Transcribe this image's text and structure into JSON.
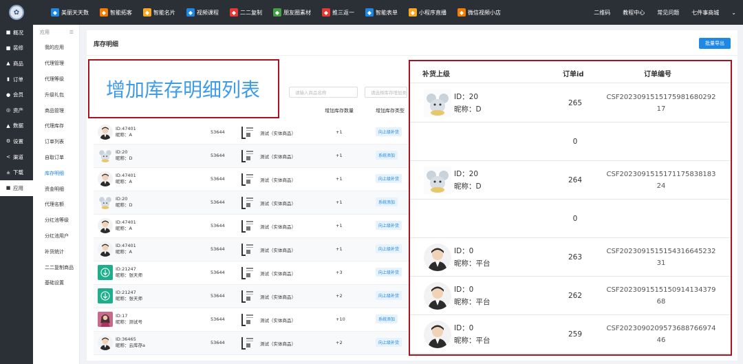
{
  "topnav": {
    "items": [
      {
        "label": "美丽天天数",
        "icon": "tag-icon",
        "color": "#1e88e5"
      },
      {
        "label": "智能拓客",
        "icon": "star-icon",
        "color": "#f57c00"
      },
      {
        "label": "智能名片",
        "icon": "card-icon",
        "color": "#f9a825"
      },
      {
        "label": "视频课程",
        "icon": "video-icon",
        "color": "#1e88e5"
      },
      {
        "label": "二二复制",
        "icon": "copy-icon",
        "color": "#e53935"
      },
      {
        "label": "朋友圈素材",
        "icon": "moments-icon",
        "color": "#43a047"
      },
      {
        "label": "推三返一",
        "icon": "gift-icon",
        "color": "#e53935"
      },
      {
        "label": "智能表单",
        "icon": "form-icon",
        "color": "#1e88e5"
      },
      {
        "label": "小程序直播",
        "icon": "live-icon",
        "color": "#f9a825"
      },
      {
        "label": "微信视频小店",
        "icon": "shop-icon",
        "color": "#f57c00"
      }
    ],
    "right": [
      "二维码",
      "教程中心",
      "常见问题",
      "七件事商城"
    ]
  },
  "sidebar": {
    "items": [
      {
        "label": "概况",
        "icon": "■"
      },
      {
        "label": "装修",
        "icon": "■"
      },
      {
        "label": "商品",
        "icon": "▲"
      },
      {
        "label": "订单",
        "icon": "▮"
      },
      {
        "label": "会员",
        "icon": "●"
      },
      {
        "label": "资产",
        "icon": "◎"
      },
      {
        "label": "数据",
        "icon": "▲"
      },
      {
        "label": "设置",
        "icon": "⚙"
      },
      {
        "label": "渠道",
        "icon": "<"
      },
      {
        "label": "下载",
        "icon": "±"
      },
      {
        "label": "应用",
        "icon": "■"
      }
    ]
  },
  "submenu": {
    "header": "应用",
    "items": [
      "我的应用",
      "代理管理",
      "代理等级",
      "升级礼包",
      "商品管理",
      "代理库存",
      "订单列表",
      "自取订单",
      "库存明细",
      "资金明细",
      "代理名额",
      "分红池等级",
      "分红池用户",
      "补货统计",
      "二二复制商品",
      "基础设置"
    ]
  },
  "main": {
    "title": "库存明细",
    "export_label": "批量导出",
    "search_product_placeholder": "请输入商品名称",
    "search_id_placeholder": "请选择库存增加类",
    "annotation": "增加库存明细列表",
    "headers": {
      "qty": "增加库存数量",
      "type": "增加库存类型"
    },
    "rows": [
      {
        "uid": "ID:47401",
        "nick": "昵称：A",
        "num": "53644",
        "product": "测试（实体商品）",
        "qty": "+1",
        "type": "向上级补货",
        "avatar": "man"
      },
      {
        "uid": "ID:20",
        "nick": "昵称：D",
        "num": "53644",
        "product": "测试（实体商品）",
        "qty": "+1",
        "type": "系统添加",
        "avatar": "mouse"
      },
      {
        "uid": "ID:47401",
        "nick": "昵称：A",
        "num": "53644",
        "product": "测试（实体商品）",
        "qty": "+1",
        "type": "向上级补货",
        "avatar": "man"
      },
      {
        "uid": "ID:20",
        "nick": "昵称：D",
        "num": "53644",
        "product": "测试（实体商品）",
        "qty": "+1",
        "type": "系统添加",
        "avatar": "mouse"
      },
      {
        "uid": "ID:47401",
        "nick": "昵称：A",
        "num": "53644",
        "product": "测试（实体商品）",
        "qty": "+1",
        "type": "向上级补货",
        "avatar": "man"
      },
      {
        "uid": "ID:47401",
        "nick": "昵称：A",
        "num": "53644",
        "product": "测试（实体商品）",
        "qty": "+1",
        "type": "向上级补货",
        "avatar": "man"
      },
      {
        "uid": "ID:21247",
        "nick": "昵称：张天师",
        "num": "53644",
        "product": "测试（实体商品）",
        "qty": "+3",
        "type": "向上级补货",
        "avatar": "green"
      },
      {
        "uid": "ID:21247",
        "nick": "昵称：张天师",
        "num": "53644",
        "product": "测试（实体商品）",
        "qty": "+2",
        "type": "向上级补货",
        "avatar": "green"
      },
      {
        "uid": "ID:17",
        "nick": "昵称：测试号",
        "num": "53644",
        "product": "测试（实体商品）",
        "qty": "+10",
        "type": "系统添加",
        "avatar": "photo"
      },
      {
        "uid": "ID:36465",
        "nick": "昵称：云库存a",
        "num": "53644",
        "product": "测试（实体商品）",
        "qty": "+2",
        "type": "向上级补货",
        "avatar": "man"
      }
    ]
  },
  "panel": {
    "headers": {
      "superior": "补货上级",
      "order_id": "订单id",
      "order_no": "订单编号"
    },
    "rows": [
      {
        "has_user": true,
        "avatar": "mouse",
        "uid": "ID：20",
        "nick": "昵称：D",
        "order_id": "265",
        "order_no": "CSF20230915151759816 8029217"
      },
      {
        "has_user": false,
        "order_id": "0",
        "order_no": ""
      },
      {
        "has_user": true,
        "avatar": "mouse",
        "uid": "ID：20",
        "nick": "昵称：D",
        "order_id": "264",
        "order_no": "CSF20230915151711758 3818324"
      },
      {
        "has_user": false,
        "order_id": "0",
        "order_no": ""
      },
      {
        "has_user": true,
        "avatar": "man",
        "uid": "ID：0",
        "nick": "昵称：平台",
        "order_id": "263",
        "order_no": "CSF20230915151543166 4523231"
      },
      {
        "has_user": true,
        "avatar": "man",
        "uid": "ID：0",
        "nick": "昵称：平台",
        "order_id": "262",
        "order_no": "CSF20230915151509141 3437968"
      },
      {
        "has_user": true,
        "avatar": "man",
        "uid": "ID：0",
        "nick": "昵称：平台",
        "order_id": "259",
        "order_no": "CSF20230902095736887 6697446"
      }
    ]
  }
}
